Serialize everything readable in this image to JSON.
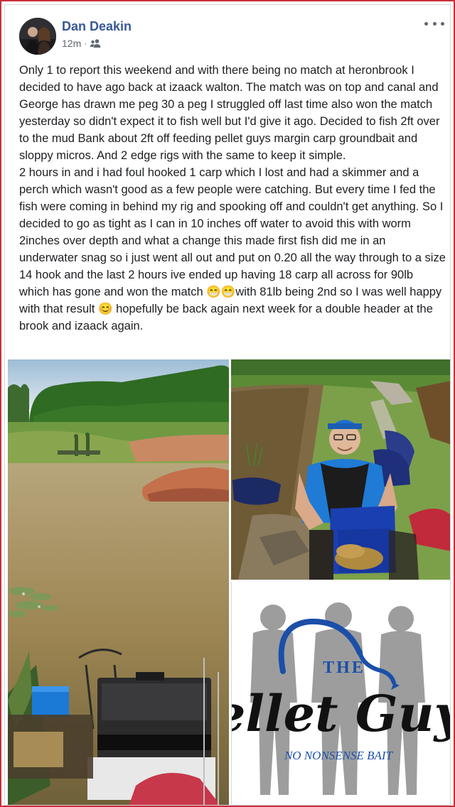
{
  "post": {
    "author": "Dan Deakin",
    "time": "12m",
    "separator": "·",
    "audience_icon": "friends-icon",
    "more_icon": "more-options-icon",
    "text": "Only 1 to report this weekend and with there being no match at heronbrook I decided to have ago back at izaack walton. The match was on top and canal and George has drawn me peg 30 a peg I struggled off last time also won the match yesterday so didn't expect it to fish well but I'd give it ago. Decided to fish 2ft over to the mud Bank about 2ft off feeding pellet guys margin carp groundbait and sloppy micros. And 2 edge rigs with the same to keep it simple.\n2 hours in and i had foul hooked 1 carp which I lost and had a skimmer and a perch which wasn't good as a few people were catching. But every time I fed the fish were coming in behind my rig and spooking off and couldn't get anything. So I decided to go as tight as I can in 10 inches off water to avoid this with worm 2inches over depth and what a change this made first fish did me in an underwater snag so i just went all out and put on 0.20 all the way through to a size 14 hook and the last 2 hours ive ended up having 18 carp all across for 90lb which has gone and won the match 😁😁with 81lb being 2nd so I was well happy with that result 😊 hopefully be back again next week for a double header at the brook and izaack again."
  },
  "photos": {
    "logo_the": "THE",
    "logo_main": "ellet Guy",
    "logo_tagline": "NO NONSENSE BAIT"
  },
  "colors": {
    "author": "#385898",
    "frame": "#c8303a"
  }
}
